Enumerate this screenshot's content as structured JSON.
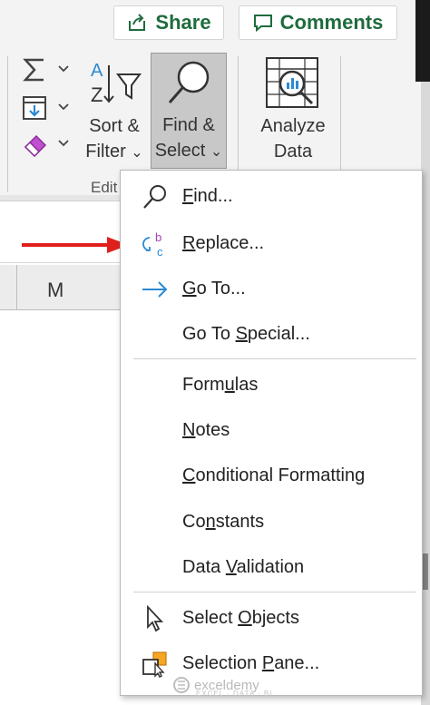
{
  "toolbar": {
    "share_label": "Share",
    "comments_label": "Comments"
  },
  "ribbon": {
    "sort_filter": {
      "line1": "Sort &",
      "line2": "Filter",
      "chevron": "⌄"
    },
    "find_select": {
      "line1": "Find &",
      "line2": "Select",
      "chevron": "⌄"
    },
    "analyze": {
      "line1": "Analyze",
      "line2": "Data"
    },
    "group_label": "Edit",
    "small_tools": [
      {
        "icon": "autosum-icon"
      },
      {
        "icon": "fill-icon"
      },
      {
        "icon": "clear-eraser-icon"
      }
    ]
  },
  "sheet": {
    "column_label": "M"
  },
  "menu": {
    "items": [
      {
        "pre": "",
        "u": "F",
        "post": "ind...",
        "icon": "magnifier-icon"
      },
      {
        "pre": "",
        "u": "R",
        "post": "eplace...",
        "icon": "replace-icon"
      },
      {
        "pre": "",
        "u": "G",
        "post": "o To...",
        "icon": "go-to-arrow-icon"
      },
      {
        "pre": "Go To ",
        "u": "S",
        "post": "pecial...",
        "icon": ""
      },
      {
        "pre": "Form",
        "u": "u",
        "post": "las",
        "icon": ""
      },
      {
        "pre": "",
        "u": "N",
        "post": "otes",
        "icon": ""
      },
      {
        "pre": "",
        "u": "C",
        "post": "onditional Formatting",
        "icon": ""
      },
      {
        "pre": "Co",
        "u": "n",
        "post": "stants",
        "icon": ""
      },
      {
        "pre": "Data ",
        "u": "V",
        "post": "alidation",
        "icon": ""
      },
      {
        "pre": "Select ",
        "u": "O",
        "post": "bjects",
        "icon": "cursor-arrow-icon"
      },
      {
        "pre": "Selection ",
        "u": "P",
        "post": "ane...",
        "icon": "selection-pane-icon"
      }
    ]
  },
  "watermark": {
    "brand": "exceldemy",
    "tagline": "EXCEL · DATA · BI"
  },
  "colors": {
    "accent_green": "#1f6b3d",
    "arrow_red": "#e0201c",
    "icon_blue": "#2a8ad4",
    "replace_purple": "#a23fb5"
  }
}
